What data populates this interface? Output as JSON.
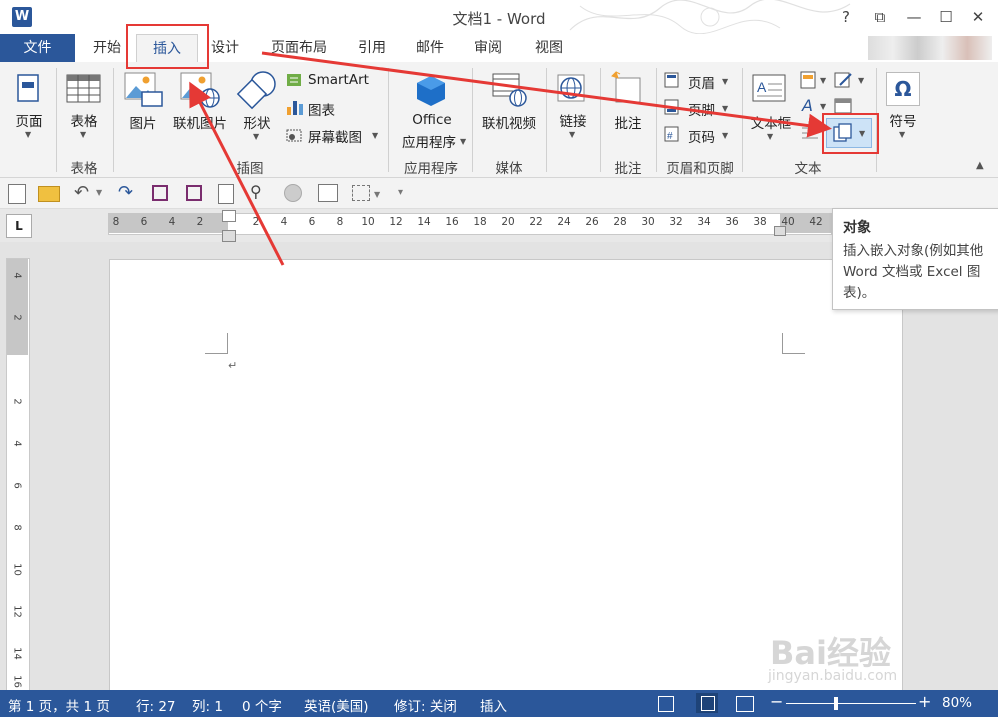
{
  "window": {
    "app_icon": "W",
    "title": "文档1 - Word",
    "help": "?",
    "restore": "⧉",
    "minimize": "—",
    "maximize": "☐",
    "close": "✕"
  },
  "tabs": {
    "file": "文件",
    "items": [
      "开始",
      "插入",
      "设计",
      "页面布局",
      "引用",
      "邮件",
      "审阅",
      "视图"
    ],
    "active": "插入"
  },
  "ribbon": {
    "pages": "页面",
    "table": "表格",
    "picture": "图片",
    "online_picture": "联机图片",
    "shapes": "形状",
    "smartart": "SmartArt",
    "chart": "图表",
    "screenshot": "屏幕截图",
    "office_apps_line1": "Office",
    "office_apps_line2": "应用程序",
    "online_video": "联机视频",
    "link": "链接",
    "comment": "批注",
    "header": "页眉",
    "footer": "页脚",
    "page_number": "页码",
    "textbox": "文本框",
    "symbol": "符号",
    "groups": {
      "table": "表格",
      "illustrations": "插图",
      "apps": "应用程序",
      "media": "媒体",
      "comments": "批注",
      "header_footer": "页眉和页脚",
      "text": "文本"
    }
  },
  "ruler": {
    "tab_selector": "L",
    "left_ticks": [
      "8",
      "6",
      "4",
      "2"
    ],
    "ticks": [
      "2",
      "4",
      "6",
      "8",
      "10",
      "12",
      "14",
      "16",
      "18",
      "20",
      "22",
      "24",
      "26",
      "28",
      "30",
      "32",
      "34",
      "36",
      "38",
      "40",
      "42"
    ],
    "vertical_ticks": [
      "4",
      "2",
      "2",
      "4",
      "6",
      "8",
      "10",
      "12",
      "14",
      "16"
    ]
  },
  "tooltip": {
    "title": "对象",
    "body": "插入嵌入对象(例如其他 Word 文档或 Excel 图表)。"
  },
  "document": {
    "paragraph_mark": "↵"
  },
  "status": {
    "page": "第 1 页，共 1 页",
    "line": "行: 27",
    "column": "列: 1",
    "words": "0 个字",
    "language": "英语(美国)",
    "track_changes": "修订: 关闭",
    "mode": "插入",
    "zoom": "80%",
    "zoom_minus": "−",
    "zoom_plus": "+"
  },
  "watermark": {
    "brand": "Bai经验",
    "url": "jingyan.baidu.com"
  },
  "colors": {
    "accent": "#2b579a",
    "annotation": "#e53935"
  }
}
